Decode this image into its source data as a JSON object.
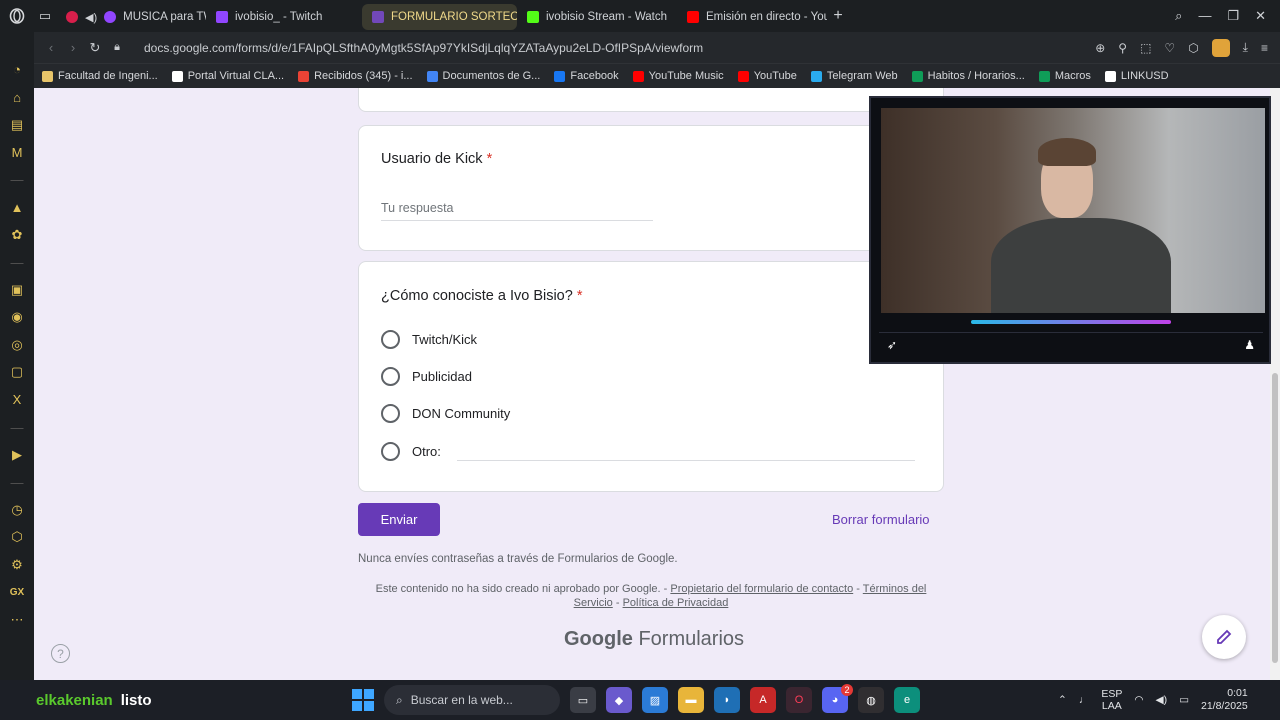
{
  "tabs": [
    {
      "label": "MUSICA para TWI",
      "color": "#d81f4b",
      "active": false
    },
    {
      "label": "ivobisio_ - Twitch",
      "color": "#9146ff",
      "active": false
    },
    {
      "label": "FORMULARIO SORTEO",
      "color": "#7248b9",
      "active": true
    },
    {
      "label": "ivobisio Stream - Watch",
      "color": "#53fc18",
      "active": false
    },
    {
      "label": "Emisión en directo - YouT",
      "color": "#ff0000",
      "active": false
    }
  ],
  "address": {
    "url": "docs.google.com/forms/d/e/1FAIpQLSfthA0yMgtk5SfAp97YkISdjLqlqYZATaAypu2eLD-OfIPSpA/viewform"
  },
  "bookmarks": [
    {
      "label": "Facultad de Ingeni...",
      "color": "#e8c56a"
    },
    {
      "label": "Portal Virtual CLA...",
      "color": "#ffffff"
    },
    {
      "label": "Recibidos (345) - i...",
      "color": "#ea4335"
    },
    {
      "label": "Documentos de G...",
      "color": "#4285f4"
    },
    {
      "label": "Facebook",
      "color": "#1877f2"
    },
    {
      "label": "YouTube Music",
      "color": "#ff0000"
    },
    {
      "label": "YouTube",
      "color": "#ff0000"
    },
    {
      "label": "Telegram Web",
      "color": "#2aabee"
    },
    {
      "label": "Habitos / Horarios...",
      "color": "#0f9d58"
    },
    {
      "label": "Macros",
      "color": "#0f9d58"
    },
    {
      "label": "LINKUSD",
      "color": "#ffffff"
    }
  ],
  "form": {
    "q1": {
      "title": "Usuario de Kick",
      "required_mark": "*",
      "placeholder": "Tu respuesta"
    },
    "q2": {
      "title": "¿Cómo conociste a Ivo Bisio?",
      "required_mark": "*",
      "options": [
        "Twitch/Kick",
        "Publicidad",
        "DON Community",
        "Otro:"
      ]
    },
    "submit_label": "Enviar",
    "clear_label": "Borrar formulario",
    "password_note": "Nunca envíes contraseñas a través de Formularios de Google.",
    "disclaimer": {
      "text": "Este contenido no ha sido creado ni aprobado por Google. -",
      "link1": "Propietario del formulario de contacto",
      "sep": "-",
      "link2": "Términos del Servicio",
      "link3": "Política de Privacidad"
    },
    "brand_google": "Google",
    "brand_forms": "Formularios"
  },
  "help_glyph": "?",
  "taskbar": {
    "stream_user": "elkakenian",
    "stream_status": "listo",
    "search_placeholder": "Buscar en la web...",
    "lang_top": "ESP",
    "lang_bottom": "LAA",
    "time": "0:01",
    "date": "21/8/2025",
    "discord_badge": "2"
  }
}
